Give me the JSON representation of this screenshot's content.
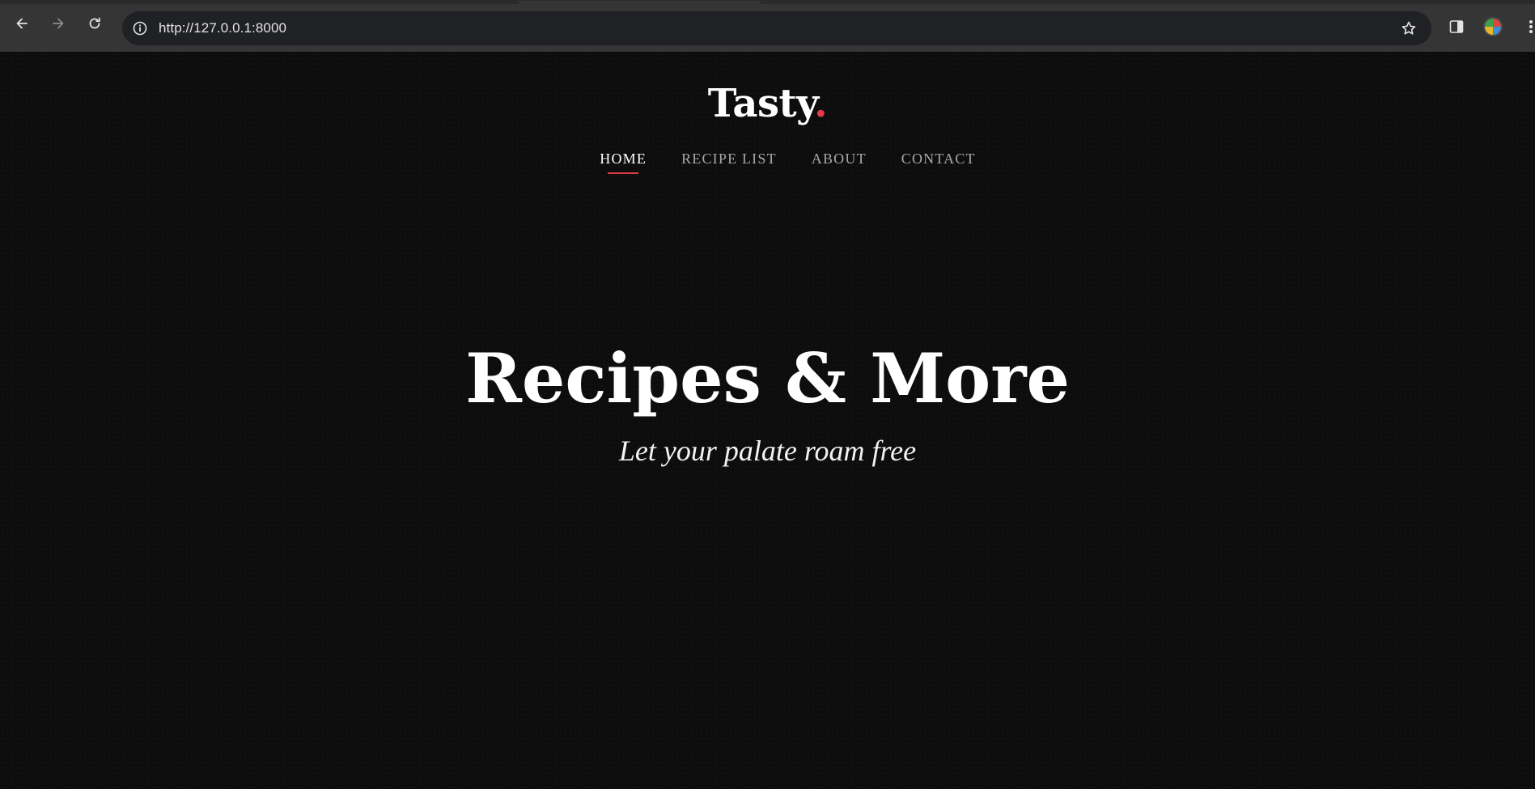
{
  "browser": {
    "url": "http://127.0.0.1:8000",
    "icons": {
      "back": "arrow-left-icon",
      "forward": "arrow-right-icon",
      "reload": "reload-icon",
      "site_info": "info-icon",
      "bookmark": "star-icon",
      "side_panel": "side-panel-icon",
      "profile": "avatar",
      "menu": "kebab-menu-icon"
    }
  },
  "site": {
    "logo_text": "Tasty",
    "logo_dot": ".",
    "accent_color": "#e23b47",
    "background_color": "#0d0d0e"
  },
  "nav": {
    "items": [
      {
        "label": "HOME",
        "active": true
      },
      {
        "label": "RECIPE LIST",
        "active": false
      },
      {
        "label": "ABOUT",
        "active": false
      },
      {
        "label": "CONTACT",
        "active": false
      }
    ]
  },
  "hero": {
    "title": "Recipes & More",
    "subtitle": "Let your palate roam free"
  }
}
